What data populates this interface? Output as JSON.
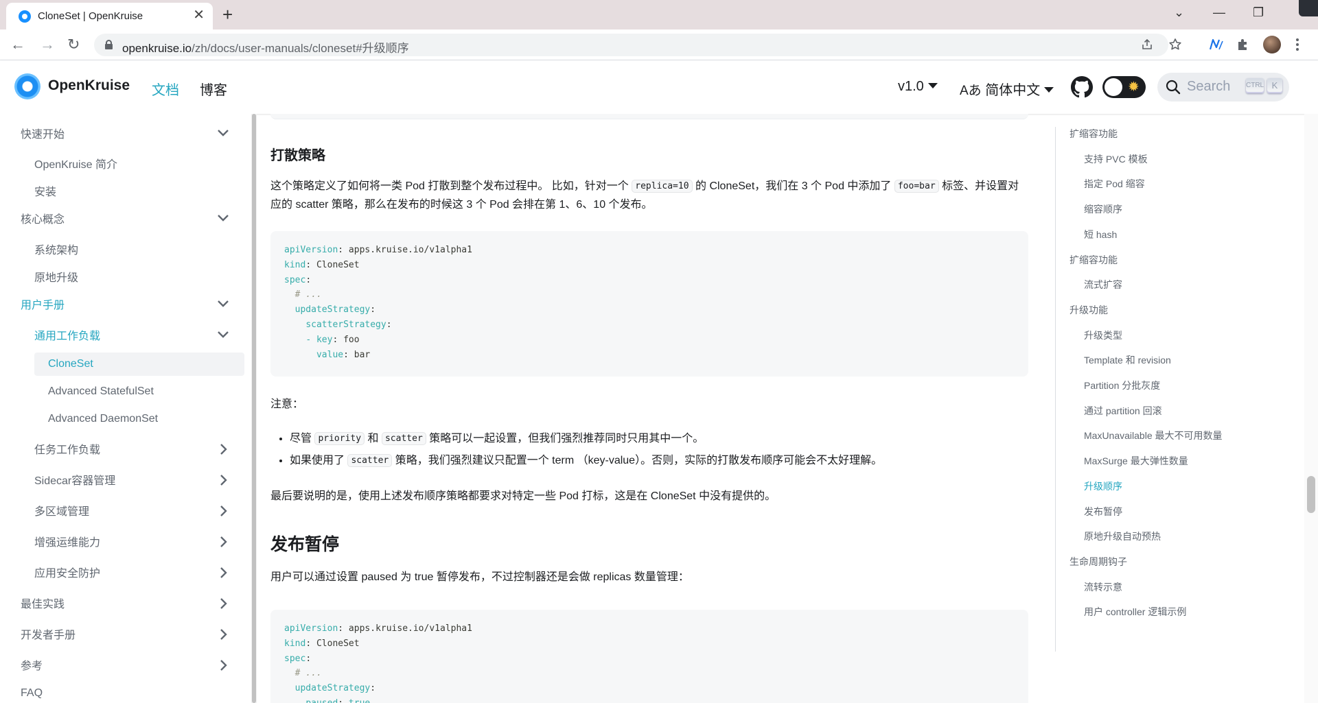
{
  "browser": {
    "tab_title": "CloneSet | OpenKruise",
    "tab_close": "✕",
    "new_tab": "+",
    "url_host": "openkruise.io",
    "url_path": "/zh/docs/user-manuals/cloneset#升级顺序",
    "win_minimize": "—",
    "win_restore": "❐",
    "win_close": "✕",
    "win_dropdown": "⌄",
    "back": "←",
    "forward": "→",
    "reload": "↻"
  },
  "header": {
    "logo": "OpenKruise",
    "nav_docs": "文档",
    "nav_blog": "博客",
    "version": "v1.0",
    "language": "简体中文",
    "language_prefix": "Aあ",
    "search_placeholder": "Search",
    "kbd_ctrl": "CTRL",
    "kbd_k": "K",
    "theme_sun": "✹"
  },
  "sidebar": {
    "items": [
      {
        "label": "快速开始",
        "chevron": "down"
      },
      {
        "label": "OpenKruise 简介"
      },
      {
        "label": "安装"
      },
      {
        "label": "核心概念",
        "chevron": "down"
      },
      {
        "label": "系统架构"
      },
      {
        "label": "原地升级"
      },
      {
        "label": "用户手册",
        "chevron": "down"
      },
      {
        "label": "通用工作负载",
        "chevron": "down"
      },
      {
        "label": "CloneSet"
      },
      {
        "label": "Advanced StatefulSet"
      },
      {
        "label": "Advanced DaemonSet"
      },
      {
        "label": "任务工作负载",
        "chevron": "right"
      },
      {
        "label": "Sidecar容器管理",
        "chevron": "right"
      },
      {
        "label": "多区域管理",
        "chevron": "right"
      },
      {
        "label": "增强运维能力",
        "chevron": "right"
      },
      {
        "label": "应用安全防护",
        "chevron": "right"
      },
      {
        "label": "最佳实践",
        "chevron": "right"
      },
      {
        "label": "开发者手册",
        "chevron": "right"
      },
      {
        "label": "参考",
        "chevron": "right"
      },
      {
        "label": "FAQ"
      }
    ]
  },
  "content": {
    "scatter_heading": "打散策略",
    "scatter_p1_a": "这个策略定义了如何将一类 Pod 打散到整个发布过程中。 比如，针对一个 ",
    "scatter_p1_code1": "replica=10",
    "scatter_p1_b": " 的 CloneSet，我们在 3 个 Pod 中添加了 ",
    "scatter_p1_code2": "foo=bar",
    "scatter_p1_c": " 标签、并设置对应的 scatter 策略，那么在发布的时候这 3 个 Pod 会排在第 1、6、10 个发布。",
    "code1": [
      {
        "k": "apiVersion",
        "v": " apps.kruise.io/v1alpha1",
        "indent": ""
      },
      {
        "k": "kind",
        "v": " CloneSet",
        "indent": ""
      },
      {
        "k": "spec",
        "v": "",
        "indent": ""
      },
      {
        "c": "# ...",
        "indent": "  "
      },
      {
        "k": "updateStrategy",
        "v": "",
        "indent": "  "
      },
      {
        "k": "scatterStrategy",
        "v": "",
        "indent": "    "
      },
      {
        "dash": "- ",
        "k": "key",
        "v": " foo",
        "indent": "    "
      },
      {
        "k": "value",
        "v": " bar",
        "indent": "      "
      }
    ],
    "note_label": "注意：",
    "note1_a": "尽管 ",
    "note1_code1": "priority",
    "note1_b": " 和 ",
    "note1_code2": "scatter",
    "note1_c": " 策略可以一起设置，但我们强烈推荐同时只用其中一个。",
    "note2_a": "如果使用了 ",
    "note2_code": "scatter",
    "note2_b": " 策略，我们强烈建议只配置一个 term （key-value）。否则，实际的打散发布顺序可能会不太好理解。",
    "final_p": "最后要说明的是，使用上述发布顺序策略都要求对特定一些 Pod 打标，这是在 CloneSet 中没有提供的。",
    "pause_heading": "发布暂停",
    "pause_p": "用户可以通过设置 paused 为 true 暂停发布，不过控制器还是会做 replicas 数量管理：",
    "code2": [
      {
        "k": "apiVersion",
        "v": " apps.kruise.io/v1alpha1",
        "indent": ""
      },
      {
        "k": "kind",
        "v": " CloneSet",
        "indent": ""
      },
      {
        "k": "spec",
        "v": "",
        "indent": ""
      },
      {
        "c": "# ...",
        "indent": "  "
      },
      {
        "k": "updateStrategy",
        "v": "",
        "indent": "  "
      },
      {
        "k": "paused",
        "v": " true",
        "indent": "    "
      }
    ]
  },
  "toc": {
    "items": [
      {
        "label": "扩缩容功能",
        "level": 0
      },
      {
        "label": "支持 PVC 模板",
        "level": 1
      },
      {
        "label": "指定 Pod 缩容",
        "level": 1
      },
      {
        "label": "缩容顺序",
        "level": 1
      },
      {
        "label": "短 hash",
        "level": 1
      },
      {
        "label": "扩缩容功能",
        "level": 0
      },
      {
        "label": "流式扩容",
        "level": 1
      },
      {
        "label": "升级功能",
        "level": 0
      },
      {
        "label": "升级类型",
        "level": 1
      },
      {
        "label": "Template 和 revision",
        "level": 1
      },
      {
        "label": "Partition 分批灰度",
        "level": 1
      },
      {
        "label": "通过 partition 回滚",
        "level": 1
      },
      {
        "label": "MaxUnavailable 最大不可用数量",
        "level": 1
      },
      {
        "label": "MaxSurge 最大弹性数量",
        "level": 1
      },
      {
        "label": "升级顺序",
        "level": 1,
        "active": true
      },
      {
        "label": "发布暂停",
        "level": 1
      },
      {
        "label": "原地升级自动预热",
        "level": 1
      },
      {
        "label": "生命周期钩子",
        "level": 0
      },
      {
        "label": "流转示意",
        "level": 1
      },
      {
        "label": "用户 controller 逻辑示例",
        "level": 1
      }
    ]
  },
  "colors": {
    "primary": "#25a6c0",
    "text": "#1c1e21",
    "muted": "#606770"
  }
}
